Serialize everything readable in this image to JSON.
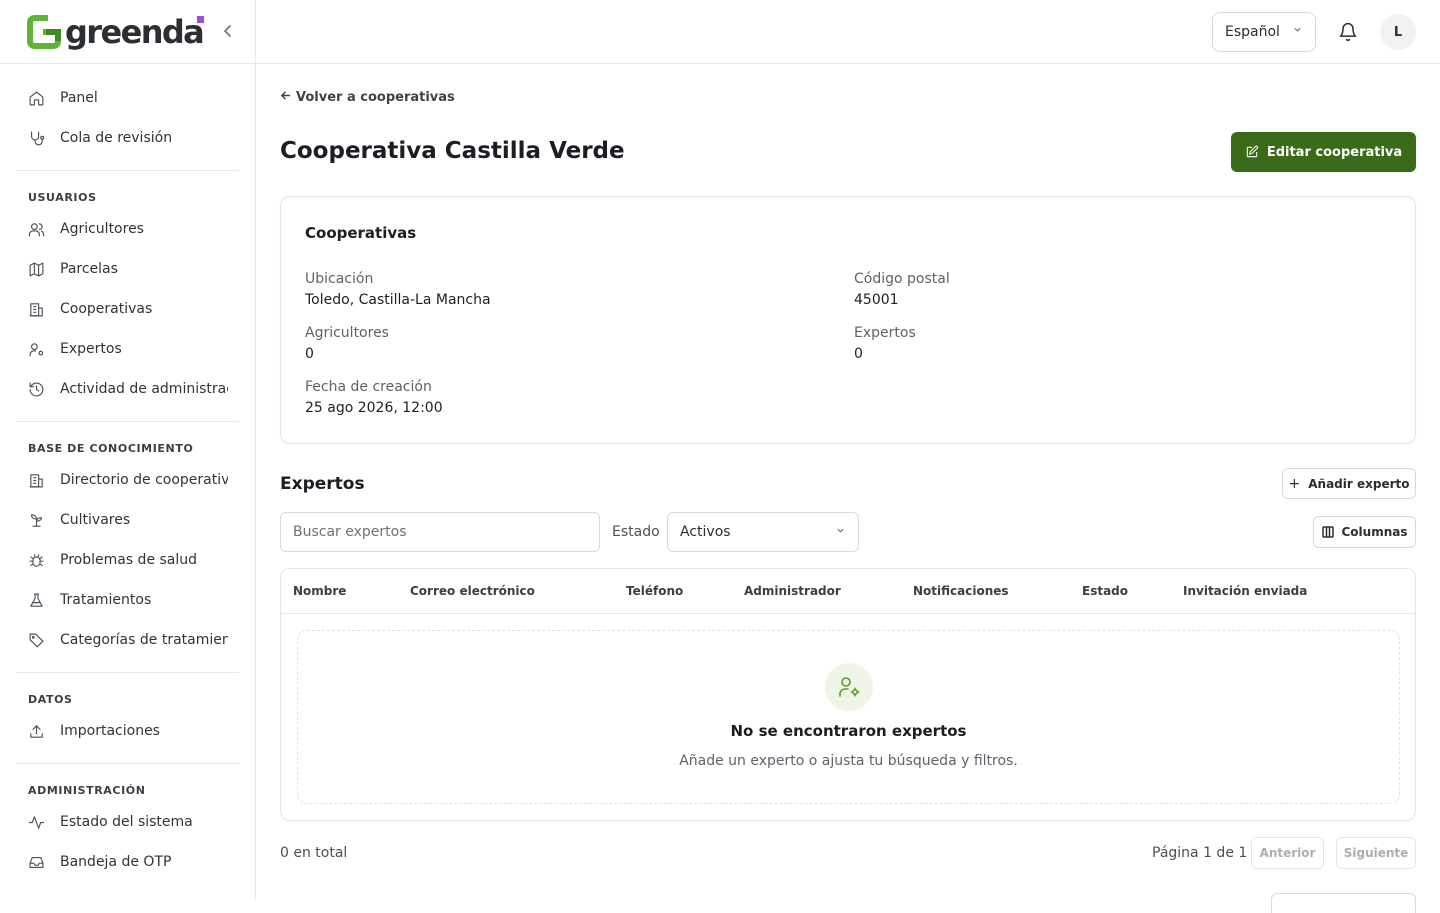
{
  "brand": {
    "name": "greenda",
    "collapse_icon": "chevron-left-icon"
  },
  "topbar": {
    "language": "Español",
    "avatar_initial": "L"
  },
  "sidebar": {
    "main_items": [
      {
        "label": "Panel",
        "icon": "home-icon"
      },
      {
        "label": "Cola de revisión",
        "icon": "stethoscope-icon"
      }
    ],
    "groups": [
      {
        "title": "USUARIOS",
        "items": [
          {
            "label": "Agricultores",
            "icon": "users-icon"
          },
          {
            "label": "Parcelas",
            "icon": "map-icon"
          },
          {
            "label": "Cooperativas",
            "icon": "building-icon"
          },
          {
            "label": "Expertos",
            "icon": "user-cog-icon"
          },
          {
            "label": "Actividad de administración",
            "icon": "history-icon"
          }
        ]
      },
      {
        "title": "BASE DE CONOCIMIENTO",
        "items": [
          {
            "label": "Directorio de cooperativas",
            "icon": "building-icon"
          },
          {
            "label": "Cultivares",
            "icon": "sprout-icon"
          },
          {
            "label": "Problemas de salud",
            "icon": "bug-icon"
          },
          {
            "label": "Tratamientos",
            "icon": "flask-icon"
          },
          {
            "label": "Categorías de tratamiento",
            "icon": "tag-icon"
          }
        ]
      },
      {
        "title": "DATOS",
        "items": [
          {
            "label": "Importaciones",
            "icon": "upload-icon"
          }
        ]
      },
      {
        "title": "ADMINISTRACIÓN",
        "items": [
          {
            "label": "Estado del sistema",
            "icon": "activity-icon"
          },
          {
            "label": "Bandeja de OTP",
            "icon": "inbox-icon"
          }
        ]
      }
    ]
  },
  "page": {
    "back_label": "Volver a cooperativas",
    "title": "Cooperativa Castilla Verde",
    "edit_label": "Editar cooperativa"
  },
  "details": {
    "card_title": "Cooperativas",
    "location_label": "Ubicación",
    "location_value": "Toledo, Castilla-La Mancha",
    "postal_label": "Código postal",
    "postal_value": "45001",
    "farmers_label": "Agricultores",
    "farmers_value": "0",
    "experts_label": "Expertos",
    "experts_value": "0",
    "created_label": "Fecha de creación",
    "created_value": "25 ago 2026, 12:00"
  },
  "experts": {
    "section_title": "Expertos",
    "add_label": "Añadir experto",
    "search_placeholder": "Buscar expertos",
    "status_label": "Estado",
    "status_value": "Activos",
    "columns_label": "Columnas",
    "headers": [
      "Nombre",
      "Correo electrónico",
      "Teléfono",
      "Administrador",
      "Notificaciones",
      "Estado",
      "Invitación enviada"
    ],
    "empty_title": "No se encontraron expertos",
    "empty_subtitle": "Añade un experto o ajusta tu búsqueda y filtros.",
    "total_label": "0 en total",
    "page_label": "Página 1 de 1",
    "prev_label": "Anterior",
    "next_label": "Siguiente"
  },
  "colors": {
    "brand_green": "#3a6b18",
    "accent_purple": "#9b4fd6",
    "icon_green": "#5b9b2a"
  }
}
